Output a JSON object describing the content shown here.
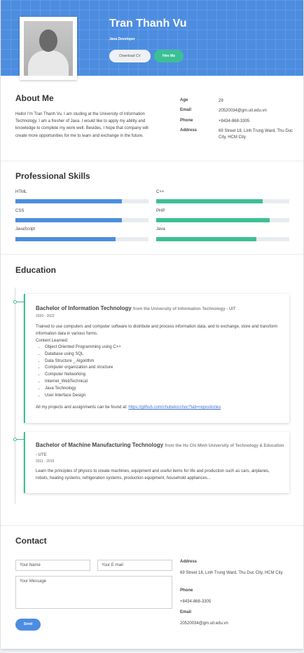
{
  "header": {
    "name": "Tran Thanh Vu",
    "role": "Java Developer",
    "download_cv_label": "Download CV",
    "hire_me_label": "Hire Me",
    "brand_color": "#4d8de0",
    "accent_color": "#3dbf95"
  },
  "about": {
    "title": "About Me",
    "text": "Hello! I'm Tran Thanh Vu. I am studing at the University of Information Technology. I am a fresher of Java. I would like to apply my ability and knowledge to complete my work well. Besides, I hope that company will create more opportunities for me to learn and exchange in the future.",
    "info": [
      {
        "label": "Age",
        "value": "29"
      },
      {
        "label": "Email",
        "value": "20520034@gm.uit.edu.vn"
      },
      {
        "label": "Phone",
        "value": "+8434-868-3305"
      },
      {
        "label": "Address",
        "value": "69 Street 18, Linh Trung Ward, Thu Duc City, HCM City"
      }
    ]
  },
  "skills": {
    "title": "Professional Skills",
    "left": [
      {
        "label": "HTML",
        "level": 0.8,
        "color": "#4d8de0"
      },
      {
        "label": "CSS",
        "level": 0.8,
        "color": "#4d8de0"
      },
      {
        "label": "JavaScript",
        "level": 0.75,
        "color": "#4d8de0"
      }
    ],
    "right": [
      {
        "label": "C++",
        "level": 0.8,
        "color": "#3dbf95"
      },
      {
        "label": "PHP",
        "level": 0.85,
        "color": "#3dbf95"
      },
      {
        "label": "Java",
        "level": 0.75,
        "color": "#3dbf95"
      }
    ]
  },
  "education": {
    "title": "Education",
    "items": [
      {
        "degree": "Bachelor of Information Technology",
        "school": "from the University of Information Technology - UIT",
        "years": "2020 - 2022",
        "description": "Trained to use computers and computer software to distribute and process information data, and to exchange, store and transform information data in various forms.",
        "courses_heading": "Content Learned:",
        "courses": [
          "Object Oriented Programming using C++",
          "Database using SQL",
          "Data Structure _ Algorithm",
          "Computer organization and structure",
          "Computer Networking",
          "Internet_WebTechnical",
          "Java Technology",
          "User Interface Design"
        ],
        "projects_text": "All my projects and assignments can be found at:",
        "projects_link": "https://github.com/chubelocchoc?tab=repositories"
      },
      {
        "degree": "Bachelor of Machine Manufacturing Technology",
        "school": "from the Ho Chi Minh University of Technology & Education - UTE",
        "years": "2011 - 2015",
        "description": "Learn the principles of physics to create machines, equipment and useful items for life and production such as cars, airplanes, robots, heating systems, refrigeration systems, production equipment, household appliances..."
      }
    ]
  },
  "contact": {
    "title": "Contact",
    "name_placeholder": "Your Name",
    "email_placeholder": "Your E-mail",
    "message_placeholder": "Your Message",
    "send_label": "Send",
    "address_label": "Address",
    "address_value": "69 Street 18, Linh Trung Ward, Thu Duc City, HCM City",
    "phone_label": "Phone",
    "phone_value": "+8434-868-3305",
    "email_label": "Email",
    "email_value": "20520034@gm.uit.edu.vn"
  }
}
